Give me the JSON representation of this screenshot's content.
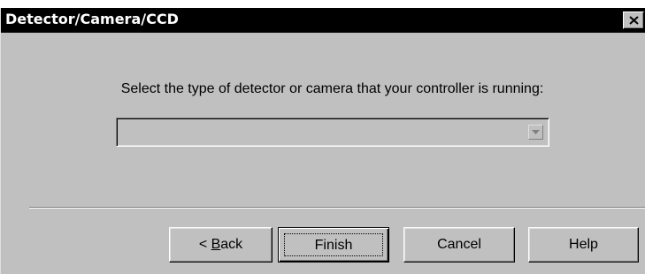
{
  "window": {
    "title": "Detector/Camera/CCD",
    "close_symbol": "×"
  },
  "content": {
    "prompt": "Select the type of detector or camera that your controller is running:",
    "combo": {
      "value": "",
      "arrow_icon": "chevron-down-icon"
    }
  },
  "buttons": {
    "back_prefix": "< ",
    "back_mnemonic": "B",
    "back_rest": "ack",
    "finish": "Finish",
    "cancel": "Cancel",
    "help": "Help"
  },
  "colors": {
    "face": "#c0c0c0",
    "titlebar": "#000000",
    "title_text": "#ffffff"
  }
}
